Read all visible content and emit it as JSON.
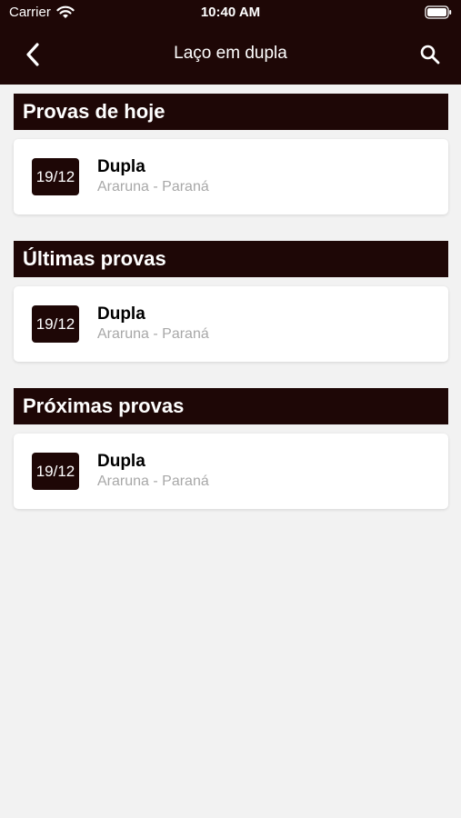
{
  "status_bar": {
    "carrier": "Carrier",
    "time": "10:40 AM"
  },
  "nav": {
    "title": "Laço em dupla",
    "back_icon": "chevron-left-icon",
    "search_icon": "search-icon"
  },
  "colors": {
    "header_bg": "#1e0706",
    "background": "#f2f2f2",
    "card_bg": "#ffffff",
    "secondary_text": "#a8a8a8"
  },
  "sections": [
    {
      "title": "Provas de hoje",
      "events": [
        {
          "date": "19/12",
          "name": "Dupla",
          "location": "Araruna - Paraná"
        }
      ]
    },
    {
      "title": "Últimas provas",
      "events": [
        {
          "date": "19/12",
          "name": "Dupla",
          "location": "Araruna - Paraná"
        }
      ]
    },
    {
      "title": "Próximas provas",
      "events": [
        {
          "date": "19/12",
          "name": "Dupla",
          "location": "Araruna - Paraná"
        }
      ]
    }
  ]
}
